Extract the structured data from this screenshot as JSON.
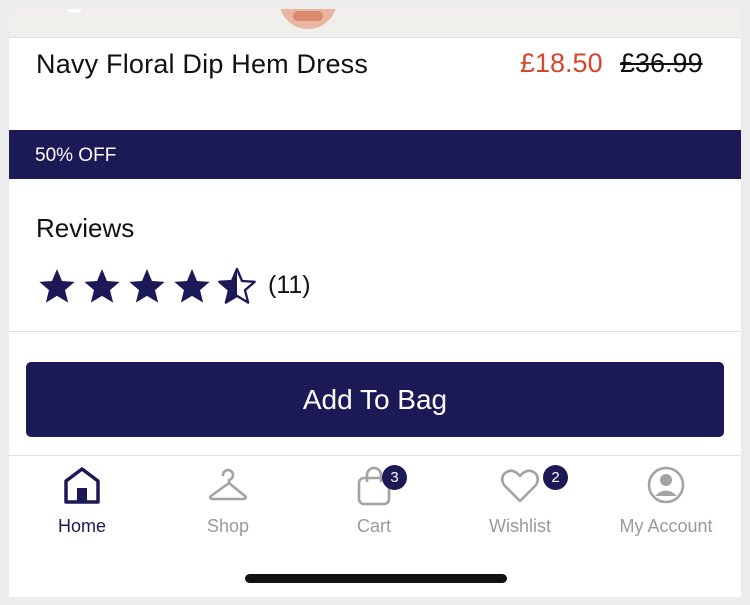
{
  "product": {
    "title": "Navy Floral Dip Hem Dress",
    "sale_price": "£18.50",
    "original_price": "£36.99",
    "discount": "50% OFF"
  },
  "reviews": {
    "heading": "Reviews",
    "rating": 4.5,
    "max_rating": 5,
    "count": "(11)"
  },
  "actions": {
    "add_to_bag": "Add To Bag"
  },
  "tabs": [
    {
      "label": "Home",
      "icon": "home-icon",
      "active": true
    },
    {
      "label": "Shop",
      "icon": "hanger-icon",
      "active": false
    },
    {
      "label": "Cart",
      "icon": "bag-icon",
      "badge": "3",
      "active": false
    },
    {
      "label": "Wishlist",
      "icon": "heart-icon",
      "badge": "2",
      "active": false
    },
    {
      "label": "My Account",
      "icon": "user-icon",
      "active": false
    }
  ],
  "colors": {
    "brand": "#1c1957",
    "sale": "#d6452e",
    "inactive": "#9a9a9a"
  }
}
